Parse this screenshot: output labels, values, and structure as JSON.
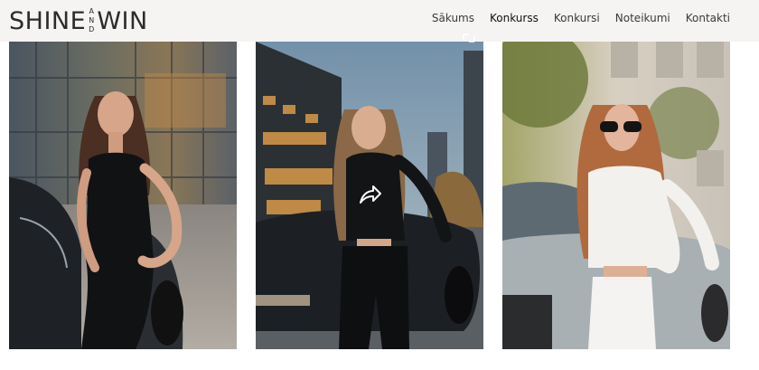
{
  "brand": {
    "word1": "SHINE",
    "mid_top": "A",
    "mid_mid": "N",
    "mid_bot": "D",
    "word2": "WIN"
  },
  "nav": {
    "items": [
      {
        "label": "Sākums"
      },
      {
        "label": "Konkurss",
        "active": true
      },
      {
        "label": "Konkursi"
      },
      {
        "label": "Noteikumi"
      },
      {
        "label": "Kontakti"
      }
    ]
  },
  "icons": {
    "share": "share-arrow-icon",
    "corner": "expand-icon"
  },
  "colors": {
    "header_bg": "#f6f3f3",
    "text": "#2c2c2c"
  }
}
